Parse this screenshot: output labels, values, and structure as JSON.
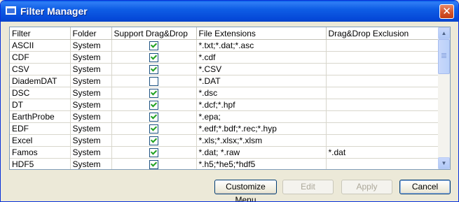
{
  "window": {
    "title": "Filter Manager"
  },
  "grid": {
    "columns": [
      "Filter",
      "Folder",
      "Support Drag&Drop",
      "File Extensions",
      "Drag&Drop Exclusion"
    ],
    "rows": [
      {
        "filter": "ASCII",
        "folder": "System",
        "dragdrop": true,
        "extensions": "*.txt;*.dat;*.asc",
        "exclusion": ""
      },
      {
        "filter": "CDF",
        "folder": "System",
        "dragdrop": true,
        "extensions": "*.cdf",
        "exclusion": ""
      },
      {
        "filter": "CSV",
        "folder": "System",
        "dragdrop": true,
        "extensions": "*.CSV",
        "exclusion": ""
      },
      {
        "filter": "DiademDAT",
        "folder": "System",
        "dragdrop": false,
        "extensions": "*.DAT",
        "exclusion": ""
      },
      {
        "filter": "DSC",
        "folder": "System",
        "dragdrop": true,
        "extensions": "*.dsc",
        "exclusion": ""
      },
      {
        "filter": "DT",
        "folder": "System",
        "dragdrop": true,
        "extensions": "*.dcf;*.hpf",
        "exclusion": ""
      },
      {
        "filter": "EarthProbe",
        "folder": "System",
        "dragdrop": true,
        "extensions": "*.epa;",
        "exclusion": ""
      },
      {
        "filter": "EDF",
        "folder": "System",
        "dragdrop": true,
        "extensions": "*.edf;*.bdf;*.rec;*.hyp",
        "exclusion": ""
      },
      {
        "filter": "Excel",
        "folder": "System",
        "dragdrop": true,
        "extensions": "*.xls;*.xlsx;*.xlsm",
        "exclusion": ""
      },
      {
        "filter": "Famos",
        "folder": "System",
        "dragdrop": true,
        "extensions": "*.dat; *.raw",
        "exclusion": "*.dat"
      },
      {
        "filter": "HDF5",
        "folder": "System",
        "dragdrop": true,
        "extensions": "*.h5;*he5;*hdf5",
        "exclusion": ""
      }
    ]
  },
  "buttons": {
    "customize_menu": "Customize Menu",
    "edit": "Edit",
    "apply": "Apply",
    "cancel": "Cancel"
  },
  "icons": {
    "close": "close-icon",
    "scroll_up": "scroll-up-icon",
    "scroll_down": "scroll-down-icon",
    "app": "window-icon"
  },
  "colors": {
    "titlebar": "#0548d8",
    "check": "#21a121",
    "dialog_bg": "#ece9d8"
  }
}
